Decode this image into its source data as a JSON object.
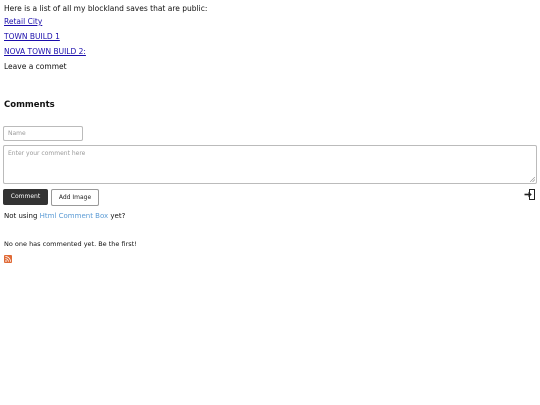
{
  "intro_text": "Here is a list of all my blockland saves that are public:",
  "saves": [
    {
      "label": "Retail City"
    },
    {
      "label": "TOWN BUILD 1"
    },
    {
      "label": "NOVA TOWN BUILD 2:"
    }
  ],
  "leave_text": "Leave a commet",
  "comments": {
    "heading": "Comments",
    "name_placeholder": "Name",
    "comment_placeholder": "Enter your comment here",
    "submit_label": "Comment",
    "add_image_label": "Add Image",
    "powered_prefix": "Not using",
    "powered_link": "Html Comment Box",
    "powered_suffix": "yet?",
    "empty_message": "No one has commented yet. Be the first!"
  },
  "icons": {
    "login": "login-icon",
    "rss": "rss-feed-icon",
    "resize": "resize-grip-icon"
  },
  "colors": {
    "link": "#1a0dab",
    "brand_link": "#5b9bd5",
    "button_dark": "#333333",
    "rss": "#e06a36"
  }
}
